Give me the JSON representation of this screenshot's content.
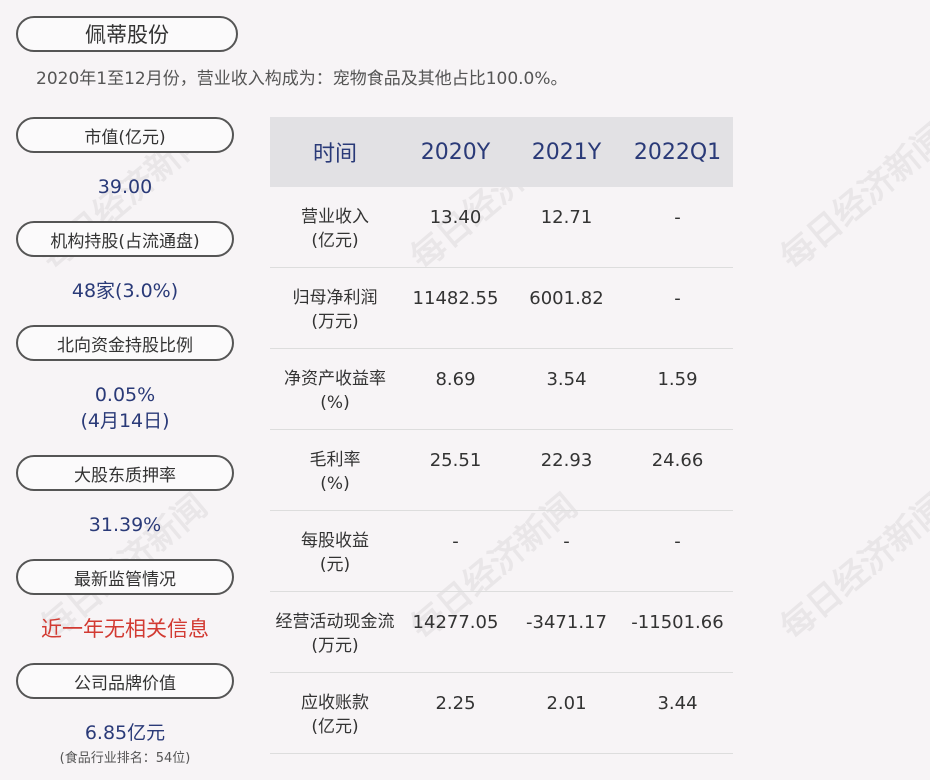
{
  "header": {
    "company": "佩蒂股份",
    "subtitle": "2020年1至12月份，营业收入构成为：宠物食品及其他占比100.0%。"
  },
  "sidebar": {
    "market_cap": {
      "label": "市值(亿元)",
      "value": "39.00"
    },
    "institutional": {
      "label": "机构持股(占流通盘)",
      "value": "48家(3.0%)"
    },
    "northbound": {
      "label": "北向资金持股比例",
      "value": "0.05%",
      "note": "(4月14日)"
    },
    "pledge": {
      "label": "大股东质押率",
      "value": "31.39%"
    },
    "regulation": {
      "label": "最新监管情况",
      "value": "近一年无相关信息"
    },
    "brand": {
      "label": "公司品牌价值",
      "value": "6.85亿元",
      "note": "(食品行业排名：54位)"
    }
  },
  "table": {
    "headers": [
      "时间",
      "2020Y",
      "2021Y",
      "2022Q1"
    ],
    "rows": [
      {
        "label": "营业收入",
        "unit": "(亿元)",
        "values": [
          "13.40",
          "12.71",
          "-"
        ]
      },
      {
        "label": "归母净利润",
        "unit": "(万元)",
        "values": [
          "11482.55",
          "6001.82",
          "-"
        ]
      },
      {
        "label": "净资产收益率",
        "unit": "(%)",
        "values": [
          "8.69",
          "3.54",
          "1.59"
        ]
      },
      {
        "label": "毛利率",
        "unit": "(%)",
        "values": [
          "25.51",
          "22.93",
          "24.66"
        ]
      },
      {
        "label": "每股收益",
        "unit": "(元)",
        "values": [
          "-",
          "-",
          "-"
        ]
      },
      {
        "label": "经营活动现金流",
        "unit": "(万元)",
        "values": [
          "14277.05",
          "-3471.17",
          "-11501.66"
        ]
      },
      {
        "label": "应收账款",
        "unit": "(亿元)",
        "values": [
          "2.25",
          "2.01",
          "3.44"
        ]
      }
    ]
  },
  "watermark": "每日经济新闻",
  "colors": {
    "value_blue": "#2a3a78",
    "alert_red": "#d23a32",
    "header_bg": "#e2e1e4"
  }
}
